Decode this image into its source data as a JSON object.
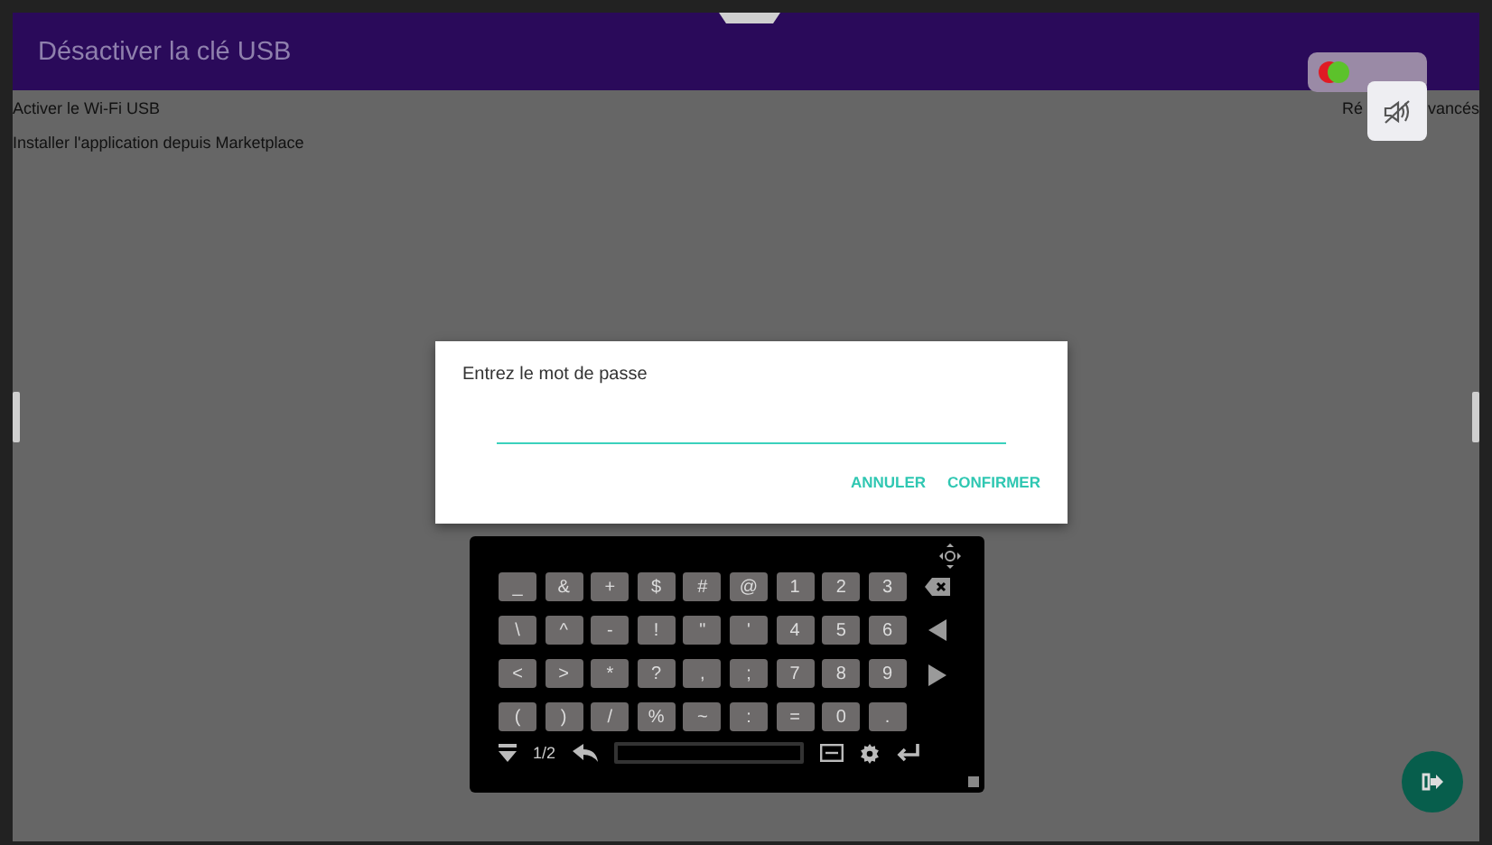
{
  "app_bar": {
    "title": "Désactiver la clé USB"
  },
  "settings": [
    {
      "label": "Activer le Wi-Fi USB"
    },
    {
      "label": "Installer l'application depuis Marketplace"
    }
  ],
  "advanced_link": {
    "visible_parts": [
      "Ré",
      "vancés"
    ]
  },
  "dialog": {
    "title": "Entrez le mot de passe",
    "buttons": [
      "ANNULER",
      "CONFIRMER"
    ]
  },
  "keyboard": {
    "rows": [
      [
        "_",
        "&",
        "+",
        "$",
        "#",
        "@",
        "1",
        "2",
        "3"
      ],
      [
        "\\",
        "^",
        "-",
        "!",
        "\"",
        "'",
        "4",
        "5",
        "6"
      ],
      [
        "<",
        ">",
        "*",
        "?",
        ",",
        ";",
        "7",
        "8",
        "9"
      ],
      [
        "(",
        ")",
        "/",
        "%",
        "~",
        ":",
        "=",
        "0",
        "."
      ]
    ],
    "side_keys": [
      {
        "kind": "backspace"
      },
      {
        "kind": "left"
      },
      {
        "kind": "right"
      }
    ],
    "page": "1/2"
  }
}
